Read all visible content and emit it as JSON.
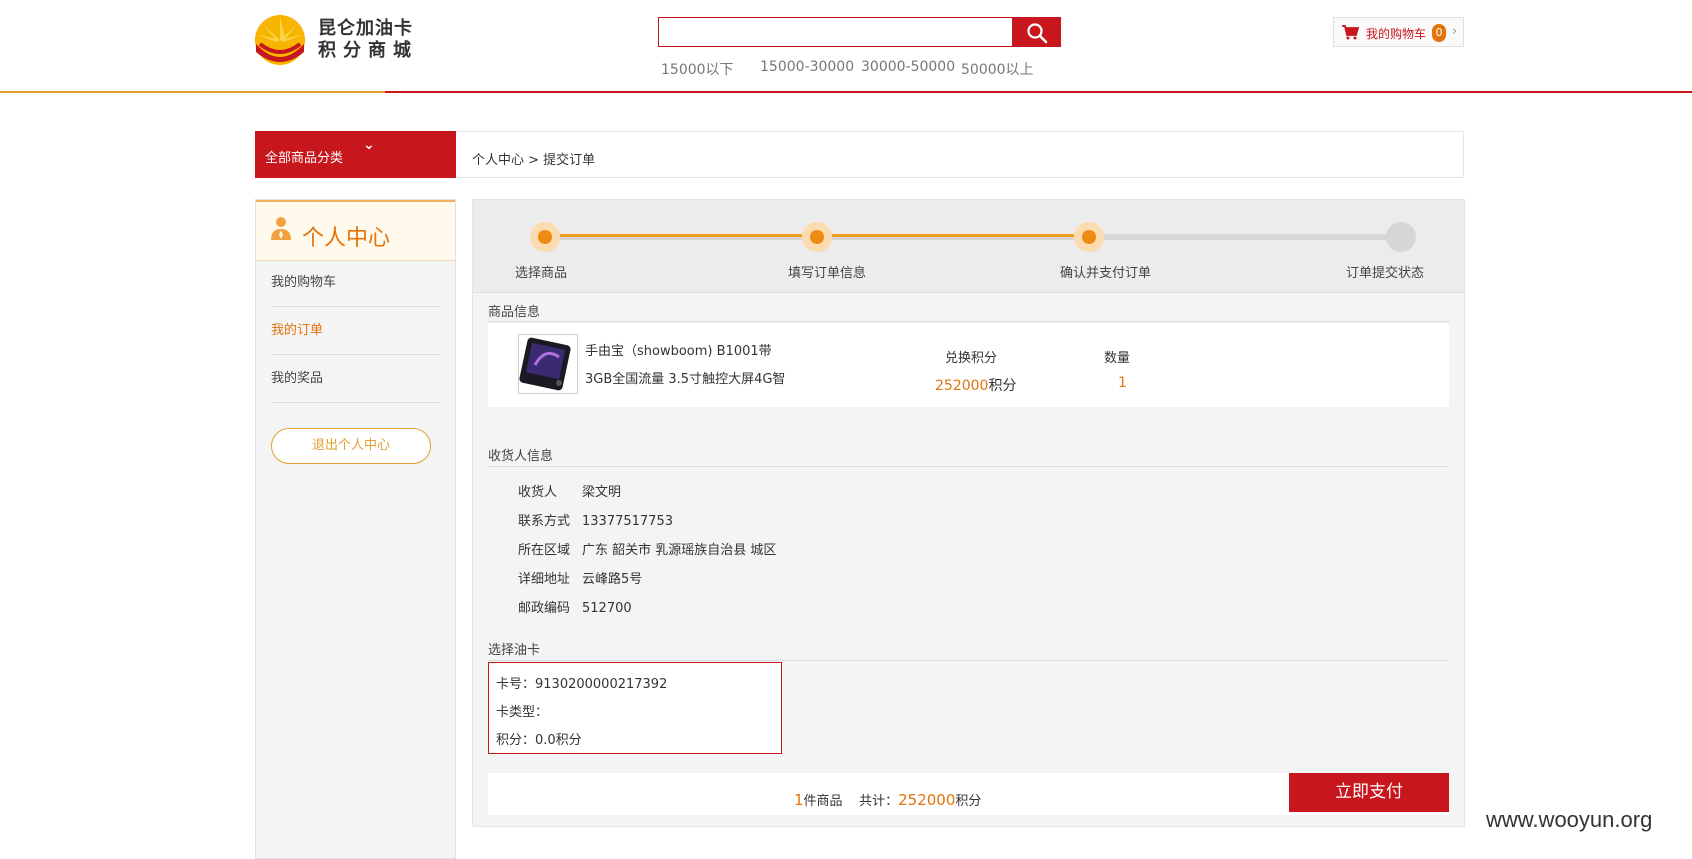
{
  "header": {
    "logo_line1": "昆仑加油卡",
    "logo_line2": "积分商城",
    "search_placeholder": "",
    "price_ranges": [
      "15000以下",
      "15000-30000",
      "30000-50000",
      "50000以上"
    ],
    "cart_label": "我的购物车",
    "cart_count": "0",
    "cart_arrow": "›"
  },
  "category": {
    "label": "全部商品分类",
    "chevron": "⌄"
  },
  "breadcrumb": "个人中心 > 提交订单",
  "sidebar": {
    "title": "个人中心",
    "items": [
      {
        "label": "我的购物车",
        "active": false
      },
      {
        "label": "我的订单",
        "active": true
      },
      {
        "label": "我的奖品",
        "active": false
      }
    ],
    "logout_label": "退出个人中心"
  },
  "steps": {
    "items": [
      "选择商品",
      "填写订单信息",
      "确认并支付订单",
      "订单提交状态"
    ],
    "completed": 3
  },
  "product": {
    "section_title": "商品信息",
    "name_line1": "手由宝（showboom) B1001带",
    "name_line2": "3GB全国流量 3.5寸触控大屏4G智",
    "points_header": "兑换积分",
    "points_value": "252000",
    "points_unit": "积分",
    "qty_header": "数量",
    "qty_value": "1"
  },
  "receiver": {
    "section_title": "收货人信息",
    "rows": [
      {
        "key": "收货人",
        "value": "梁文明"
      },
      {
        "key": "联系方式",
        "value": "13377517753"
      },
      {
        "key": "所在区域",
        "value": "广东 韶关市 乳源瑶族自治县 城区"
      },
      {
        "key": "详细地址",
        "value": "云峰路5号"
      },
      {
        "key": "邮政编码",
        "value": "512700"
      }
    ]
  },
  "card": {
    "section_title": "选择油卡",
    "number": "卡号：9130200000217392",
    "type": "卡类型：",
    "points": "积分：0.0积分"
  },
  "summary": {
    "count": "1",
    "count_label": "件商品",
    "total_label": "共计：",
    "total_value": "252000",
    "total_unit": "积分",
    "pay_button": "立即支付"
  },
  "watermark": "www.wooyun.org",
  "colors": {
    "brand_red": "#c8161d",
    "accent_orange": "#e3730a",
    "gold": "#e3a030"
  }
}
